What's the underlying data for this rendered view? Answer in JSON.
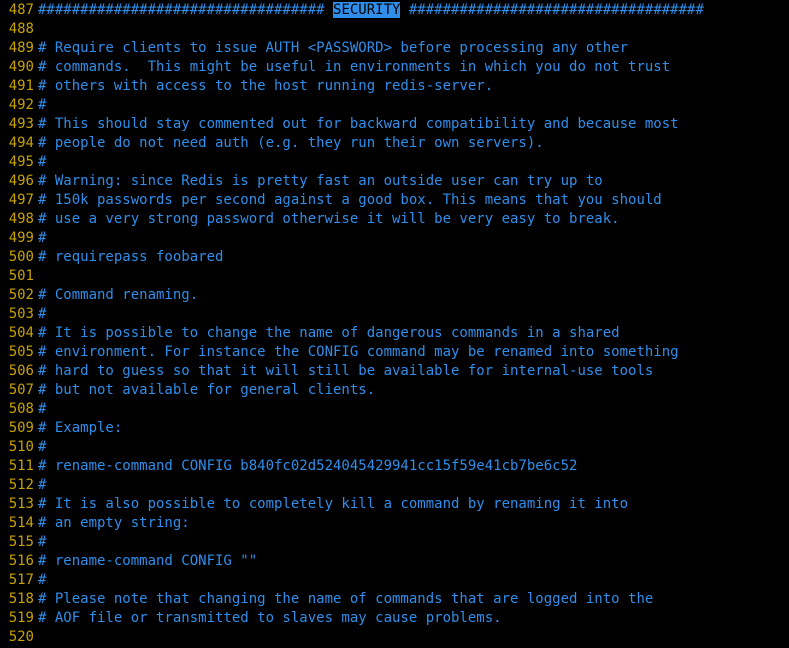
{
  "lines": [
    {
      "num": "487",
      "pre": "################################## ",
      "hl": "SECURITY",
      "post": " ###################################"
    },
    {
      "num": "488",
      "text": ""
    },
    {
      "num": "489",
      "text": "# Require clients to issue AUTH <PASSWORD> before processing any other"
    },
    {
      "num": "490",
      "text": "# commands.  This might be useful in environments in which you do not trust"
    },
    {
      "num": "491",
      "text": "# others with access to the host running redis-server."
    },
    {
      "num": "492",
      "text": "#"
    },
    {
      "num": "493",
      "text": "# This should stay commented out for backward compatibility and because most"
    },
    {
      "num": "494",
      "text": "# people do not need auth (e.g. they run their own servers)."
    },
    {
      "num": "495",
      "text": "#"
    },
    {
      "num": "496",
      "text": "# Warning: since Redis is pretty fast an outside user can try up to"
    },
    {
      "num": "497",
      "text": "# 150k passwords per second against a good box. This means that you should"
    },
    {
      "num": "498",
      "text": "# use a very strong password otherwise it will be very easy to break."
    },
    {
      "num": "499",
      "text": "#"
    },
    {
      "num": "500",
      "text": "# requirepass foobared"
    },
    {
      "num": "501",
      "text": ""
    },
    {
      "num": "502",
      "text": "# Command renaming."
    },
    {
      "num": "503",
      "text": "#"
    },
    {
      "num": "504",
      "text": "# It is possible to change the name of dangerous commands in a shared"
    },
    {
      "num": "505",
      "text": "# environment. For instance the CONFIG command may be renamed into something"
    },
    {
      "num": "506",
      "text": "# hard to guess so that it will still be available for internal-use tools"
    },
    {
      "num": "507",
      "text": "# but not available for general clients."
    },
    {
      "num": "508",
      "text": "#"
    },
    {
      "num": "509",
      "text": "# Example:"
    },
    {
      "num": "510",
      "text": "#"
    },
    {
      "num": "511",
      "text": "# rename-command CONFIG b840fc02d524045429941cc15f59e41cb7be6c52"
    },
    {
      "num": "512",
      "text": "#"
    },
    {
      "num": "513",
      "text": "# It is also possible to completely kill a command by renaming it into"
    },
    {
      "num": "514",
      "text": "# an empty string:"
    },
    {
      "num": "515",
      "text": "#"
    },
    {
      "num": "516",
      "text": "# rename-command CONFIG \"\""
    },
    {
      "num": "517",
      "text": "#"
    },
    {
      "num": "518",
      "text": "# Please note that changing the name of commands that are logged into the"
    },
    {
      "num": "519",
      "text": "# AOF file or transmitted to slaves may cause problems."
    },
    {
      "num": "520",
      "text": ""
    }
  ]
}
